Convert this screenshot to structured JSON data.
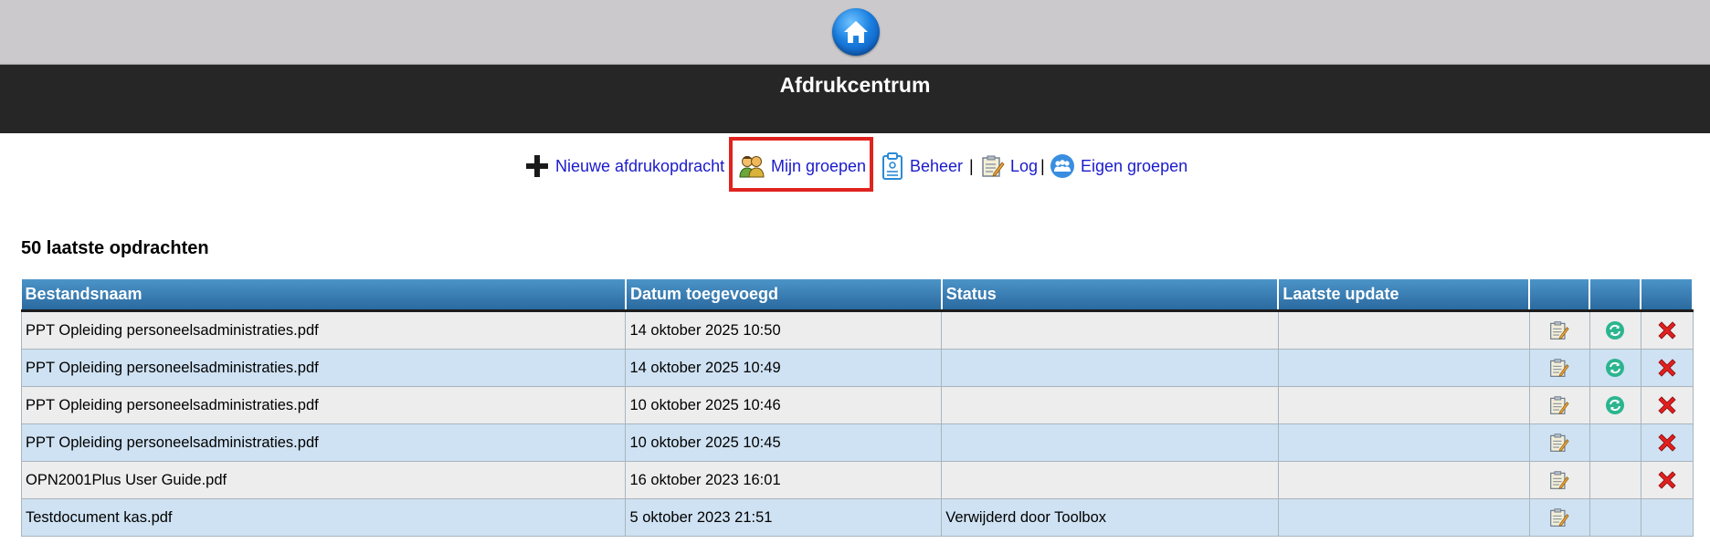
{
  "header": {
    "home_icon": "home-icon",
    "title": "Afdrukcentrum"
  },
  "nav": {
    "items": [
      {
        "label": "Nieuwe afdrukopdracht",
        "icon": "plus-icon"
      },
      {
        "label": "Mijn groepen",
        "icon": "users-icon"
      },
      {
        "label": "Beheer",
        "icon": "clipboard-icon"
      },
      {
        "label": "Log",
        "icon": "log-icon"
      },
      {
        "label": "Eigen groepen",
        "icon": "group-icon"
      }
    ],
    "separator": "|",
    "highlighted": "Mijn groepen"
  },
  "section_title": "50 laatste opdrachten",
  "table": {
    "columns": [
      "Bestandsnaam",
      "Datum toegevoegd",
      "Status",
      "Laatste update",
      "",
      "",
      ""
    ],
    "rows": [
      {
        "file": "PPT Opleiding personeelsadministraties.pdf",
        "added": "14 oktober 2025 10:50",
        "status": "",
        "updated": "",
        "edit": true,
        "refresh": true,
        "delete": true
      },
      {
        "file": "PPT Opleiding personeelsadministraties.pdf",
        "added": "14 oktober 2025 10:49",
        "status": "",
        "updated": "",
        "edit": true,
        "refresh": true,
        "delete": true
      },
      {
        "file": "PPT Opleiding personeelsadministraties.pdf",
        "added": "10 oktober 2025 10:46",
        "status": "",
        "updated": "",
        "edit": true,
        "refresh": true,
        "delete": true
      },
      {
        "file": "PPT Opleiding personeelsadministraties.pdf",
        "added": "10 oktober 2025 10:45",
        "status": "",
        "updated": "",
        "edit": true,
        "refresh": false,
        "delete": true
      },
      {
        "file": "OPN2001Plus User Guide.pdf",
        "added": "16 oktober 2023 16:01",
        "status": "",
        "updated": "",
        "edit": true,
        "refresh": false,
        "delete": true
      },
      {
        "file": "Testdocument kas.pdf",
        "added": "5 oktober 2023 21:51",
        "status": "Verwijderd door Toolbox",
        "updated": "",
        "edit": true,
        "refresh": false,
        "delete": false
      }
    ]
  },
  "colors": {
    "topbar": "#cbc9cb",
    "titlebar": "#262626",
    "link": "#1a1acc",
    "highlight": "#e0231f",
    "header_blue": "#2a6aa0",
    "row_odd": "#ededed",
    "row_even": "#cfe2f3"
  }
}
